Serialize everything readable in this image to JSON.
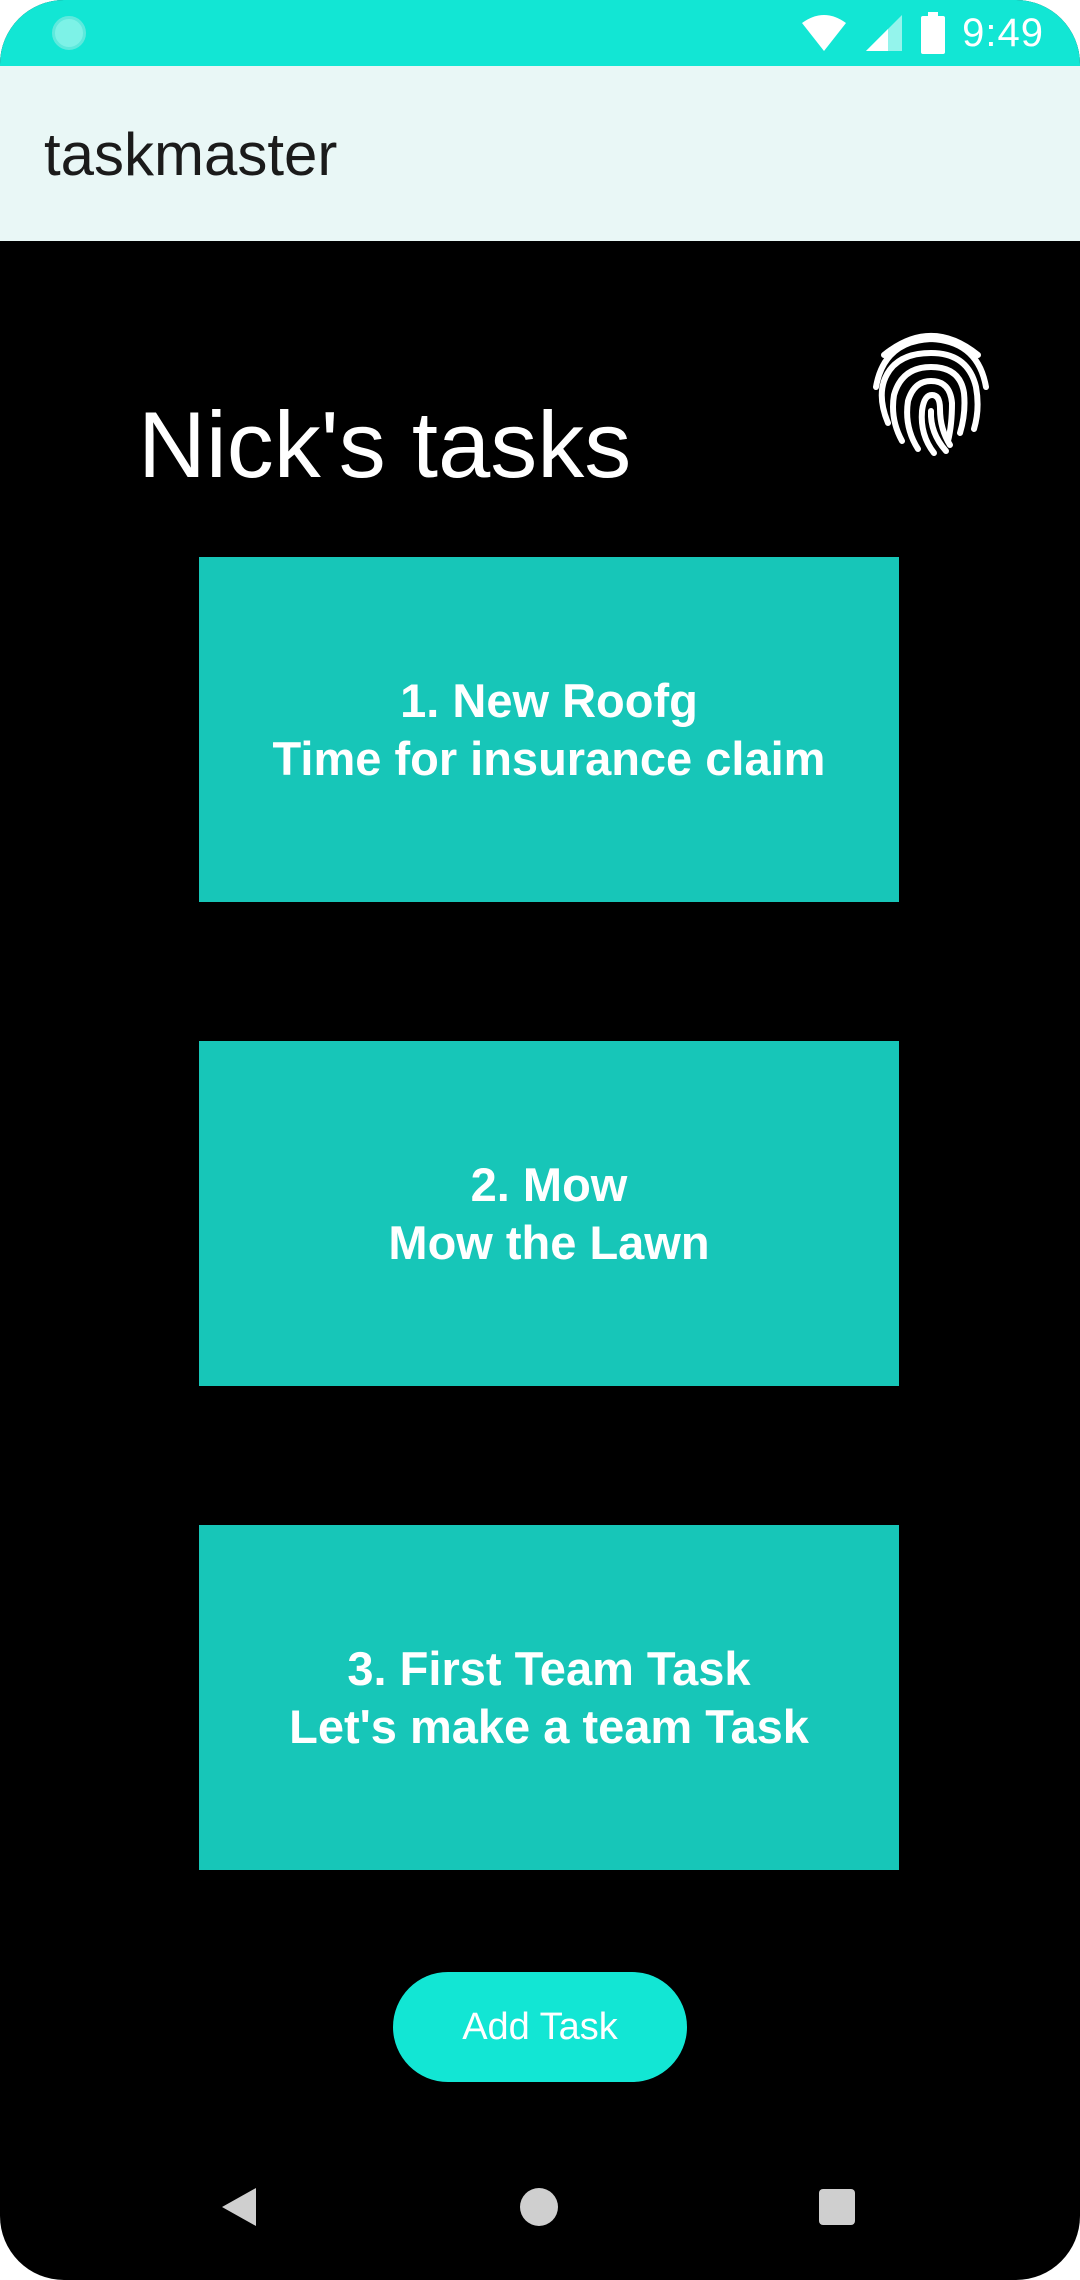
{
  "status_bar": {
    "time": "9:49",
    "icons": [
      "notification-dot-icon",
      "wifi-icon",
      "signal-icon",
      "battery-icon"
    ]
  },
  "app_bar": {
    "title": "taskmaster"
  },
  "main": {
    "heading": "Nick's tasks",
    "fingerprint_icon": "fingerprint-icon",
    "tasks": [
      {
        "title": "1. New Roofg",
        "body": "Time for insurance claim"
      },
      {
        "title": "2. Mow",
        "body": "Mow the Lawn"
      },
      {
        "title": "3. First Team Task",
        "body": "Let's make a team Task"
      }
    ],
    "add_button_label": "Add Task"
  },
  "nav_bar": {
    "icons": [
      "back-icon",
      "home-icon",
      "recents-icon"
    ]
  },
  "colors": {
    "accent": "#12E6D4",
    "card": "#17C6B8",
    "app_bar": "#E9F7F6",
    "background": "#000000"
  }
}
